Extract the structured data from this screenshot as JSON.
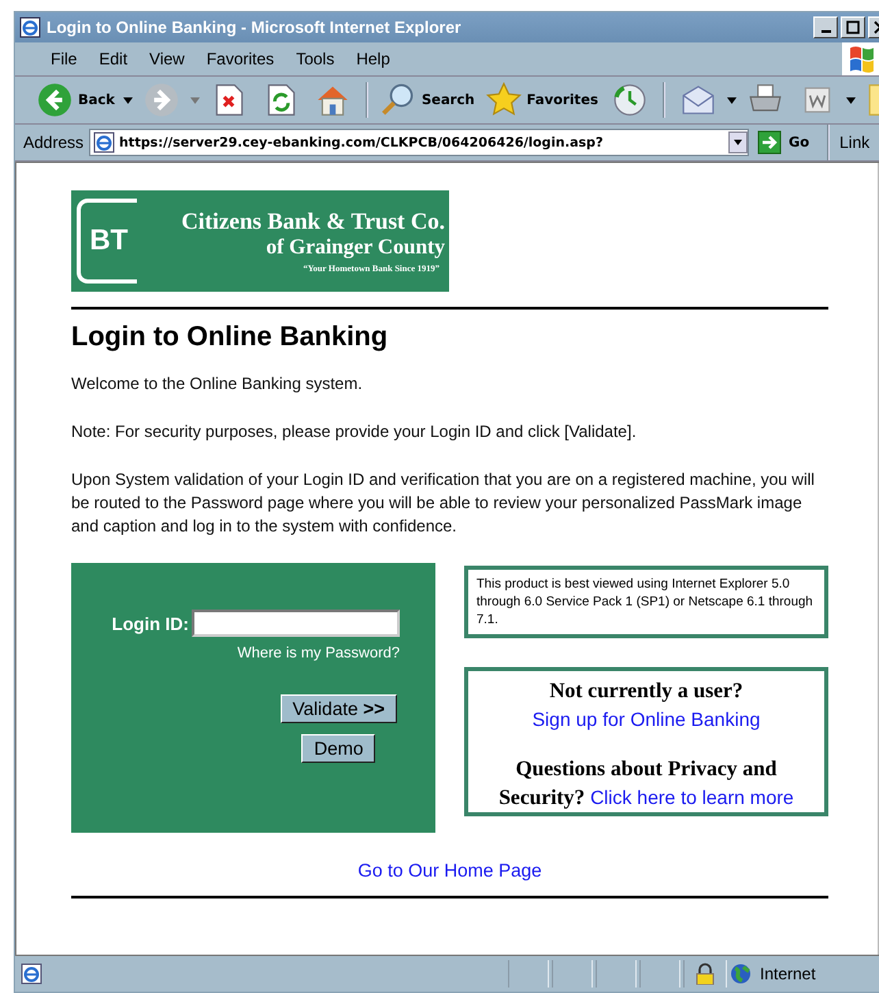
{
  "window": {
    "title": "Login to Online Banking - Microsoft Internet Explorer"
  },
  "menu": [
    {
      "label": "File"
    },
    {
      "label": "Edit"
    },
    {
      "label": "View"
    },
    {
      "label": "Favorites"
    },
    {
      "label": "Tools"
    },
    {
      "label": "Help"
    }
  ],
  "toolbar": {
    "back": "Back",
    "search": "Search",
    "favorites": "Favorites"
  },
  "address": {
    "label": "Address",
    "url": "https://server29.cey-ebanking.com/CLKPCB/064206426/login.asp?",
    "go": "Go",
    "links": "Link"
  },
  "page": {
    "logo": {
      "initials": "BT",
      "line1": "Citizens Bank & Trust Co.",
      "line2": "of Grainger County",
      "tagline": "“Your Hometown Bank Since 1919”"
    },
    "heading": "Login to Online Banking",
    "paragraphs": [
      "Welcome to the Online Banking system.",
      "Note: For security purposes, please provide your Login ID and click [Validate].",
      "Upon System validation of your Login ID and verification that you are on a registered machine, you will be routed to the Password page where you will be able to review your personalized PassMark image and caption and log in to the system with confidence."
    ],
    "login": {
      "label": "Login ID:",
      "help_link": "Where is my Password?",
      "buttons": [
        "Validate **>>**",
        "Demo"
      ]
    },
    "browser_note": "This product is best viewed using Internet Explorer 5.0 through 6.0 Service Pack 1 (SP1) or Netscape 6.1 through 7.1.",
    "help_items": [
      {
        "question": "Not currently a user?",
        "link": "Sign up for Online Banking"
      },
      {
        "question": "Questions about Privacy and Security?",
        "link": "Click here to learn more"
      }
    ],
    "home_link": "Go to Our Home Page"
  },
  "status_bar": {
    "zone": "Internet"
  }
}
